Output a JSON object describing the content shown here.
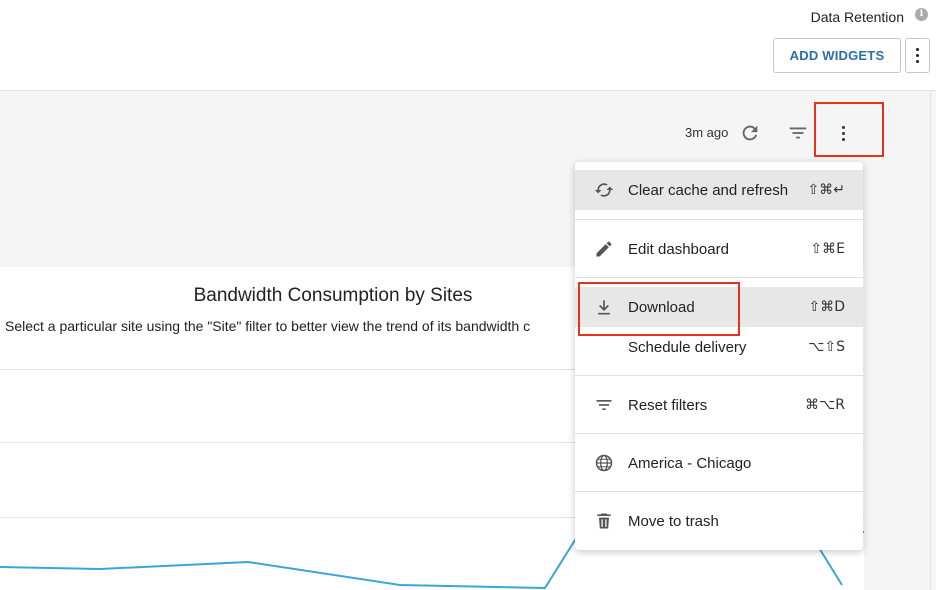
{
  "header": {
    "data_retention": "Data Retention",
    "info_icon": "i",
    "add_widgets": "ADD WIDGETS",
    "more_icon": "kebab-vertical-icon"
  },
  "toolbar": {
    "time_ago": "3m ago",
    "refresh_icon": "refresh-icon",
    "filter_icon": "filter-icon",
    "more_icon": "kebab-vertical-icon"
  },
  "tile": {
    "title": "Bandwidth Consumption by Sites",
    "subtitle": "Select a particular site using the \"Site\" filter to better view the trend of its bandwidth c"
  },
  "menu": {
    "items": [
      {
        "label": "Clear cache and refresh",
        "shortcut": "⇧⌘↵",
        "icon": "refresh-cache-icon"
      },
      {
        "label": "Edit dashboard",
        "shortcut": "⇧⌘E",
        "icon": "pencil-icon"
      },
      {
        "label": "Download",
        "shortcut": "⇧⌘D",
        "icon": "download-icon"
      },
      {
        "label": "Schedule delivery",
        "shortcut": "⌥⇧S",
        "icon": ""
      },
      {
        "label": "Reset filters",
        "shortcut": "⌘⌥R",
        "icon": "filter-icon"
      },
      {
        "label": "America - Chicago",
        "shortcut": "",
        "icon": "globe-icon"
      },
      {
        "label": "Move to trash",
        "shortcut": "",
        "icon": "trash-icon"
      }
    ]
  },
  "colors": {
    "accent": "#2c6fa8",
    "highlight": "#e5321f",
    "line": "#3aa6d6"
  }
}
